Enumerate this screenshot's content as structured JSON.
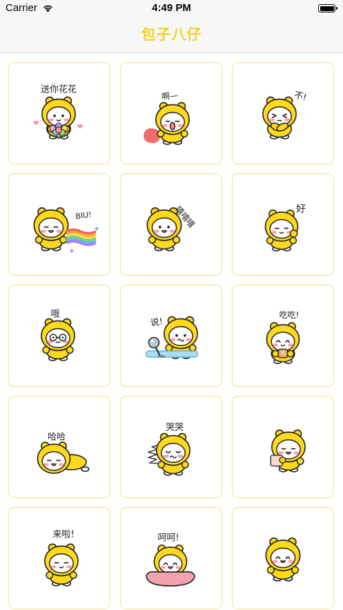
{
  "status_bar": {
    "carrier": "Carrier",
    "time": "4:49 PM",
    "wifi_icon": "wifi-icon",
    "battery_icon": "battery-full-icon"
  },
  "nav": {
    "title": "包子八仔"
  },
  "colors": {
    "accent": "#F5D22A",
    "card_border": "#F2E28D",
    "character_yellow": "#FFD91A"
  },
  "stickers": [
    {
      "caption": "送你花花"
    },
    {
      "caption": "啊—"
    },
    {
      "caption": "不!"
    },
    {
      "caption": "BIU!"
    },
    {
      "caption": "嘻嘻嘻"
    },
    {
      "caption": "好"
    },
    {
      "caption": "哦"
    },
    {
      "caption": "说!"
    },
    {
      "caption": "吃吃!"
    },
    {
      "caption": "哈哈"
    },
    {
      "caption": "哭哭"
    },
    {
      "caption": ""
    },
    {
      "caption": "来啦!"
    },
    {
      "caption": "呵呵!"
    },
    {
      "caption": ""
    }
  ]
}
